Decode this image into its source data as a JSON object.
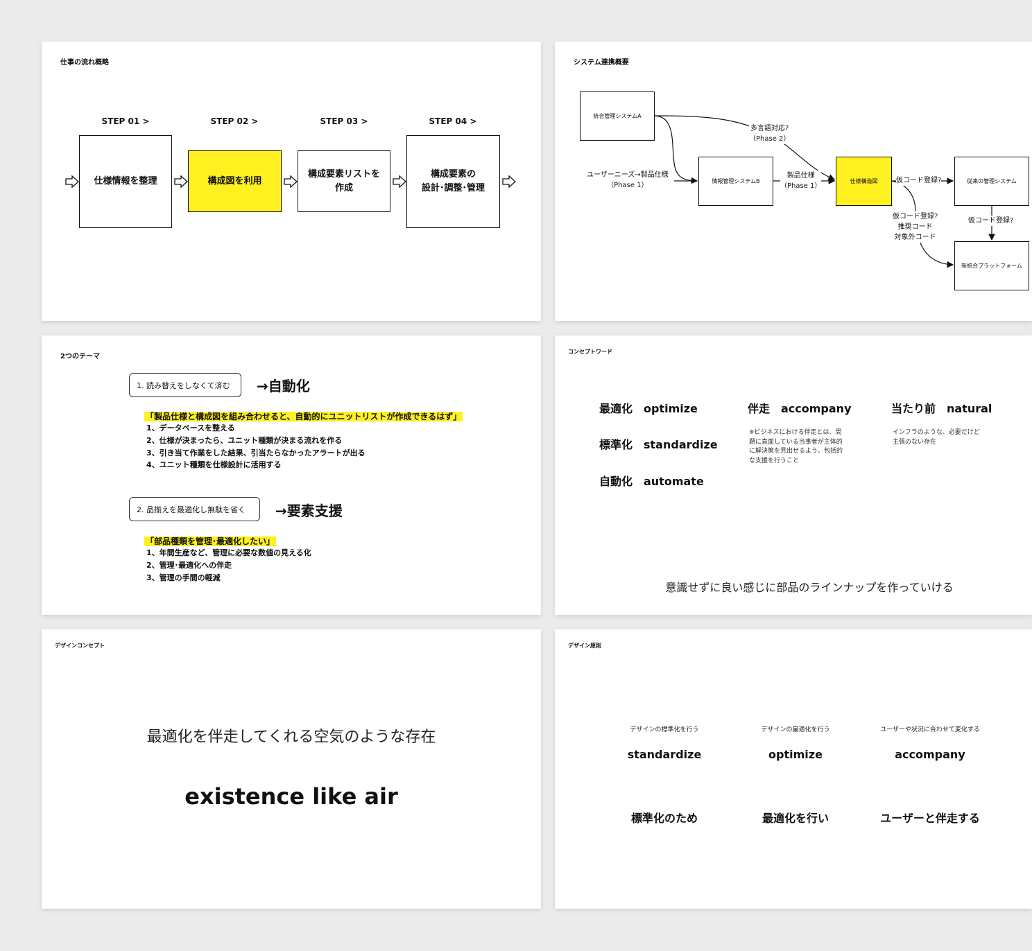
{
  "slide1": {
    "title": "仕事の流れ概略",
    "steps": [
      {
        "label": "STEP 01 >",
        "text": "仕様情報を整理"
      },
      {
        "label": "STEP 02 >",
        "text": "構成図を利用"
      },
      {
        "label": "STEP 03 >",
        "text": "構成要素リストを\n作成"
      },
      {
        "label": "STEP 04 >",
        "text": "構成要素の\n設計･調整･管理"
      }
    ]
  },
  "slide2": {
    "title": "システム連携概要",
    "boxes": {
      "integrated_a": "統合管理システムA",
      "info_b": "情報管理システムB",
      "spec_diagram": "仕様構造図",
      "legacy": "従来の管理システム",
      "new_platform": "新統合プラットフォーム"
    },
    "labels": {
      "multilang": "多言語対応?\n（Phase 2）",
      "user_needs": "ユーザーニーズ→製品仕様\n（Phase 1）",
      "product_spec": "製品仕様\n（Phase 1）",
      "temp_code": "仮コード登録?",
      "temp_code_down": "仮コード登録?",
      "temp_code_multi": "仮コード登録?\n推奨コード\n対象外コード"
    }
  },
  "slide3": {
    "title": "2つのテーマ",
    "theme1": {
      "box": "1. 読み替えをしなくて済む",
      "result": "→自動化",
      "highlight": "「製品仕様と構成図を組み合わせると、自動的にユニットリストが作成できるはず」",
      "items": [
        "1、データベースを整える",
        "2、仕様が決まったら、ユニット種類が決まる流れを作る",
        "3、引き当て作業をした結果、引当たらなかったアラートが出る",
        "4、ユニット種類を仕様設計に活用する"
      ]
    },
    "theme2": {
      "box": "2. 品揃えを最適化し無駄を省く",
      "result": "→要素支援",
      "highlight": "「部品種類を管理･最適化したい」",
      "items": [
        "1、年間生産など、管理に必要な数値の見える化",
        "2、管理･最適化への伴走",
        "3、管理の手間の軽減"
      ]
    }
  },
  "slide4": {
    "title": "コンセプトワード",
    "words": [
      "最適化　optimize",
      "標準化　standardize",
      "自動化　automate",
      "伴走　accompany",
      "当たり前　natural"
    ],
    "note_accompany": "※ビジネスにおける伴走とは、問\n題に直面している当事者が主体的\nに解決策を見出せるよう、包括的\nな支援を行うこと",
    "note_natural": "インフラのような、必要だけど\n主張のない存在",
    "tagline": "意識せずに良い感じに部品のラインナップを作っていける"
  },
  "slide5": {
    "title": "デザインコンセプト",
    "jp": "最適化を伴走してくれる空気のような存在",
    "en": "existence like air"
  },
  "slide6": {
    "title": "デザイン原則",
    "principles": [
      {
        "sub": "デザインの標準化を行う",
        "word": "standardize",
        "jp": "標準化のため"
      },
      {
        "sub": "デザインの最適化を行う",
        "word": "optimize",
        "jp": "最適化を行い"
      },
      {
        "sub": "ユーザーや状況に合わせて変化する",
        "word": "accompany",
        "jp": "ユーザーと伴走する"
      }
    ]
  }
}
